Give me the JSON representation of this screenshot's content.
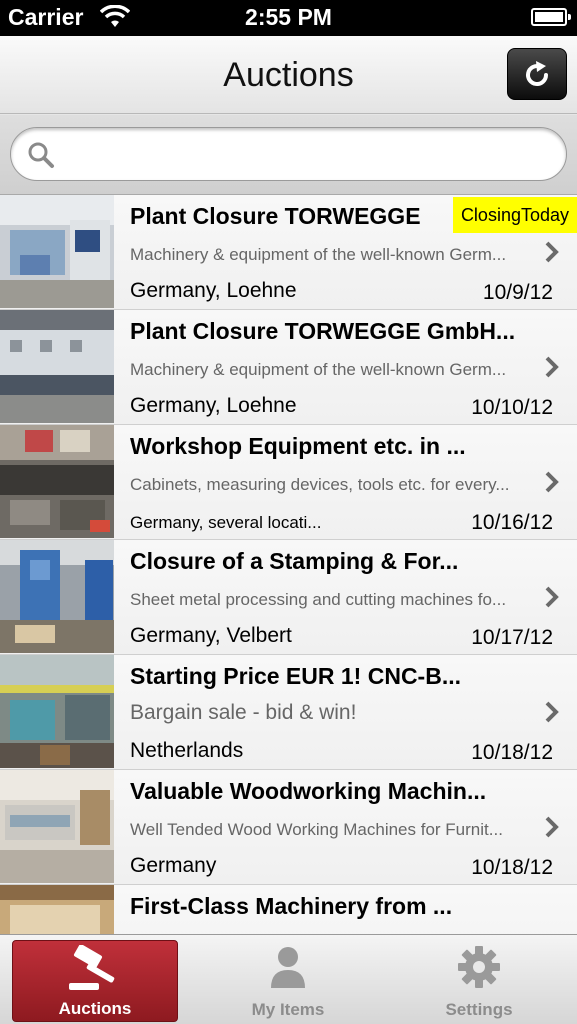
{
  "status_bar": {
    "carrier": "Carrier",
    "time": "2:55 PM"
  },
  "nav": {
    "title": "Auctions",
    "refresh_icon": "refresh-icon"
  },
  "search": {
    "placeholder": "",
    "value": ""
  },
  "badge_color": "#ffff00",
  "auctions": [
    {
      "title": "Plant Closure TORWEGGE",
      "badge": "ClosingToday",
      "description": "Machinery & equipment of the well-known Germ...",
      "location": "Germany, Loehne",
      "date": "10/9/12"
    },
    {
      "title": "Plant Closure TORWEGGE GmbH...",
      "badge": "",
      "description": "Machinery & equipment of the well-known Germ...",
      "location": "Germany, Loehne",
      "date": "10/10/12"
    },
    {
      "title": "Workshop Equipment etc. in ...",
      "badge": "",
      "description": "Cabinets, measuring devices, tools etc. for every...",
      "location": "Germany, several locati...",
      "date": "10/16/12"
    },
    {
      "title": "Closure of a Stamping & For...",
      "badge": "",
      "description": "Sheet metal processing and cutting machines fo...",
      "location": "Germany, Velbert",
      "date": "10/17/12"
    },
    {
      "title": "Starting Price EUR 1! CNC-B...",
      "badge": "",
      "description": "Bargain sale - bid & win!",
      "location": "Netherlands",
      "date": "10/18/12"
    },
    {
      "title": "Valuable Woodworking Machin...",
      "badge": "",
      "description": "Well Tended Wood Working Machines for Furnit...",
      "location": "Germany",
      "date": "10/18/12"
    },
    {
      "title": "First-Class Machinery from ...",
      "badge": "",
      "description": "",
      "location": "",
      "date": ""
    }
  ],
  "tabs": [
    {
      "label": "Auctions",
      "icon": "gavel-icon",
      "active": true
    },
    {
      "label": "My Items",
      "icon": "person-icon",
      "active": false
    },
    {
      "label": "Settings",
      "icon": "gear-icon",
      "active": false
    }
  ],
  "colors": {
    "tab_active": "#b02a32",
    "nav_bg": "#f0f0f0",
    "status_bg": "#000000"
  }
}
